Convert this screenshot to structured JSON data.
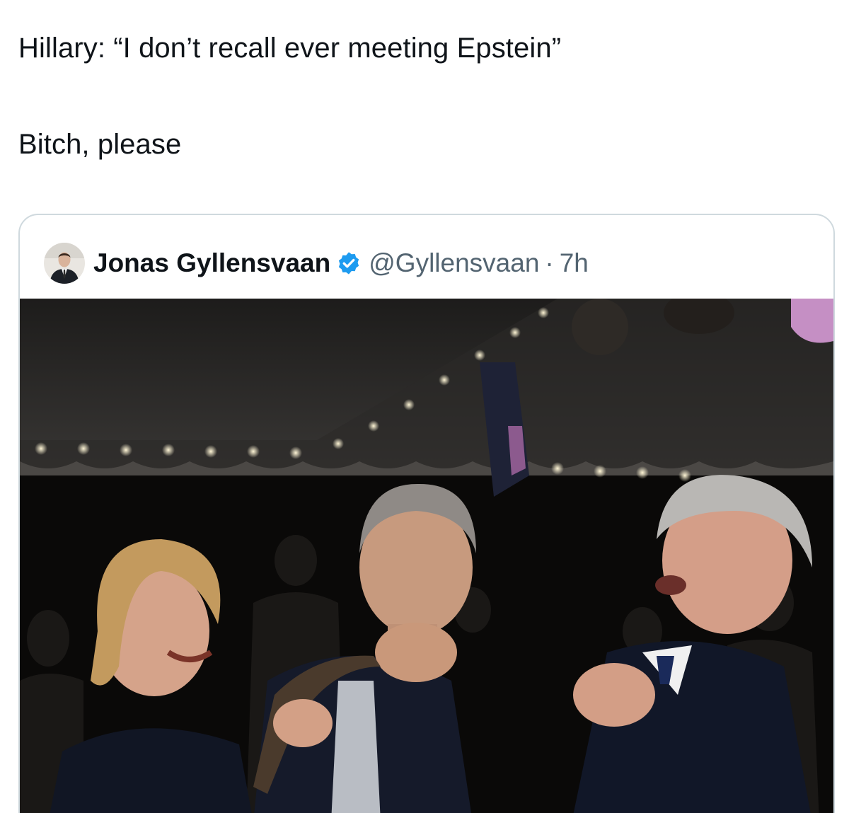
{
  "post": {
    "line1": "Hillary: “I don’t recall ever meeting Epstein”",
    "line2": "Bitch, please"
  },
  "quoted_post": {
    "author_name": "Jonas Gyllensvaan",
    "handle": "@Gyllensvaan",
    "separator": "·",
    "time_ago": "7h",
    "verified": true,
    "verified_color": "#1d9bf0",
    "avatar_icon": "profile-photo-avatar",
    "media_icon": "party-photo"
  },
  "colors": {
    "text": "#0f1419",
    "secondary_text": "#536471",
    "card_border": "#cfd9de"
  }
}
